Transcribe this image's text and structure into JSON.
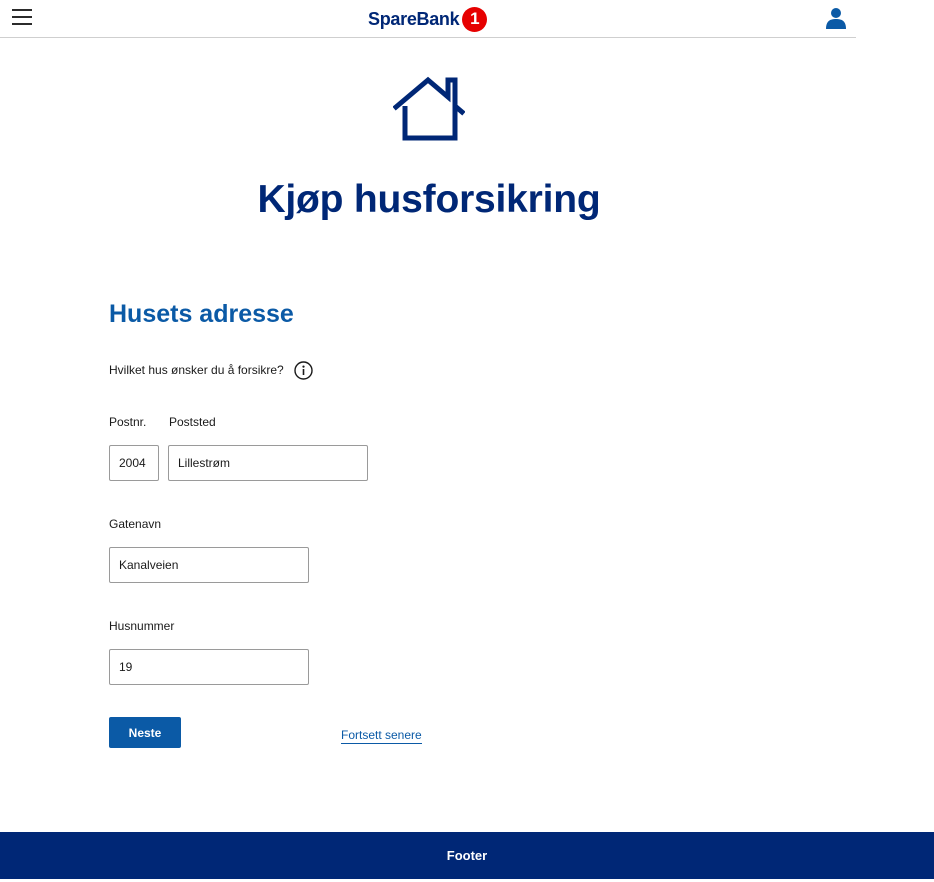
{
  "header": {
    "logo_text": "SpareBank",
    "logo_badge": "1",
    "menu_icon": "hamburger-menu-icon",
    "user_icon": "user-icon"
  },
  "hero": {
    "icon": "house-icon",
    "title": "Kjøp husforsikring"
  },
  "form": {
    "section_title": "Husets adresse",
    "question": "Hvilket hus ønsker du å forsikre?",
    "info_icon": "info-icon",
    "postnr": {
      "label": "Postnr.",
      "value": "2004"
    },
    "poststed": {
      "label": "Poststed",
      "value": "Lillestrøm"
    },
    "gatenavn": {
      "label": "Gatenavn",
      "value": "Kanalveien"
    },
    "husnummer": {
      "label": "Husnummer",
      "value": "19"
    },
    "next_label": "Neste",
    "later_label": "Fortsett senere"
  },
  "footer": {
    "label": "Footer"
  },
  "colors": {
    "navy": "#002776",
    "blue": "#0b5aa6",
    "red": "#e60000"
  }
}
